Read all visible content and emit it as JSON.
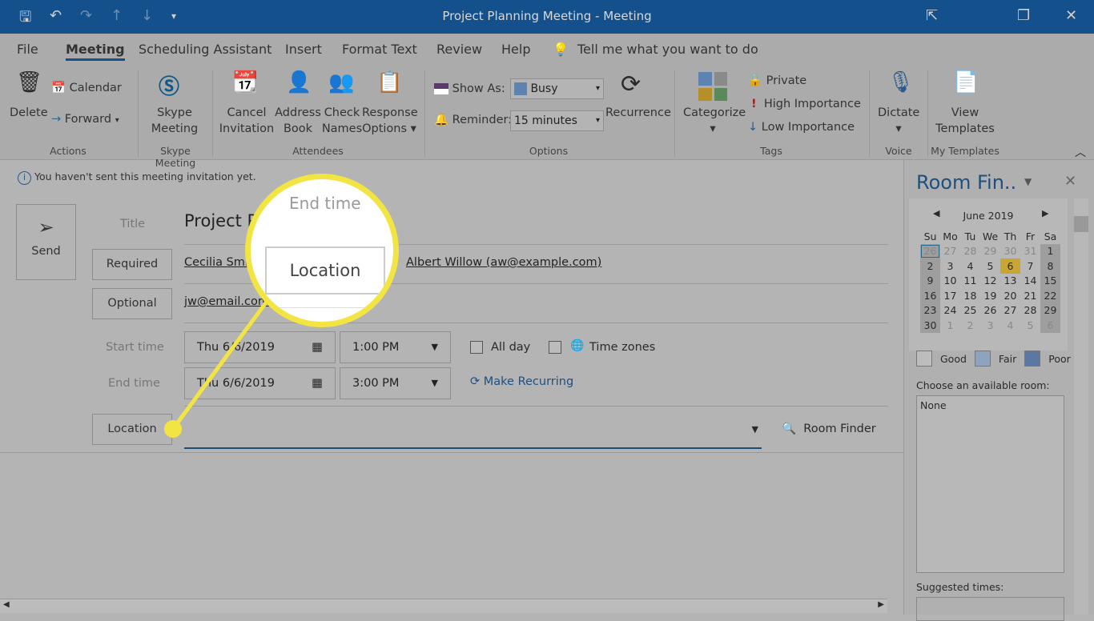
{
  "window": {
    "title": "Project Planning Meeting  -  Meeting"
  },
  "menu": [
    "File",
    "Meeting",
    "Scheduling Assistant",
    "Insert",
    "Format Text",
    "Review",
    "Help"
  ],
  "tell_me": "Tell me what you want to do",
  "ribbon": {
    "delete": "Delete",
    "calendar": "Calendar",
    "forward": "Forward",
    "actions": "Actions",
    "skype1": "Skype",
    "skype2": "Meeting",
    "skype_group": "Skype Meeting",
    "cancel1": "Cancel",
    "cancel2": "Invitation",
    "address1": "Address",
    "address2": "Book",
    "check1": "Check",
    "check2": "Names",
    "response1": "Response",
    "response2": "Options",
    "attendees": "Attendees",
    "show_as": "Show As:",
    "show_as_value": "Busy",
    "reminder": "Reminder:",
    "reminder_value": "15 minutes",
    "recurrence": "Recurrence",
    "options": "Options",
    "categorize": "Categorize",
    "private": "Private",
    "high": "High Importance",
    "low": "Low Importance",
    "tags": "Tags",
    "dictate": "Dictate",
    "voice": "Voice",
    "view1": "View",
    "view2": "Templates",
    "my_templates": "My Templates"
  },
  "info": "You haven't sent this meeting invitation yet.",
  "form": {
    "send": "Send",
    "title_label": "Title",
    "title_value": "Project Planning Meeting",
    "required": "Required",
    "required_value1": "Cecilia Smith",
    "required_value2": "Albert Willow (aw@example.com)",
    "optional": "Optional",
    "optional_value": "jw@email.com",
    "start_label": "Start time",
    "start_date": "Thu 6/6/2019",
    "start_time": "1:00 PM",
    "end_label": "End time",
    "end_date": "Thu 6/6/2019",
    "end_time": "3:00 PM",
    "all_day": "All day",
    "time_zones": "Time zones",
    "make_recurring": "Make Recurring",
    "location": "Location",
    "location_value": "",
    "room_finder": "Room Finder"
  },
  "magnifier": {
    "top_text": "End time",
    "label": "Location"
  },
  "room_finder": {
    "title": "Room Fin..",
    "month": "June 2019",
    "days": [
      "Su",
      "Mo",
      "Tu",
      "We",
      "Th",
      "Fr",
      "Sa"
    ],
    "weeks": [
      [
        "26",
        "27",
        "28",
        "29",
        "30",
        "31",
        "1"
      ],
      [
        "2",
        "3",
        "4",
        "5",
        "6",
        "7",
        "8"
      ],
      [
        "9",
        "10",
        "11",
        "12",
        "13",
        "14",
        "15"
      ],
      [
        "16",
        "17",
        "18",
        "19",
        "20",
        "21",
        "22"
      ],
      [
        "23",
        "24",
        "25",
        "26",
        "27",
        "28",
        "29"
      ],
      [
        "30",
        "1",
        "2",
        "3",
        "4",
        "5",
        "6"
      ]
    ],
    "legend": [
      "Good",
      "Fair",
      "Poor"
    ],
    "choose": "Choose an available room:",
    "room_value": "None",
    "suggested": "Suggested times:"
  },
  "colors": {
    "accent": "#14508c",
    "highlight": "#f2e543",
    "selected_day": "#c9a634"
  }
}
